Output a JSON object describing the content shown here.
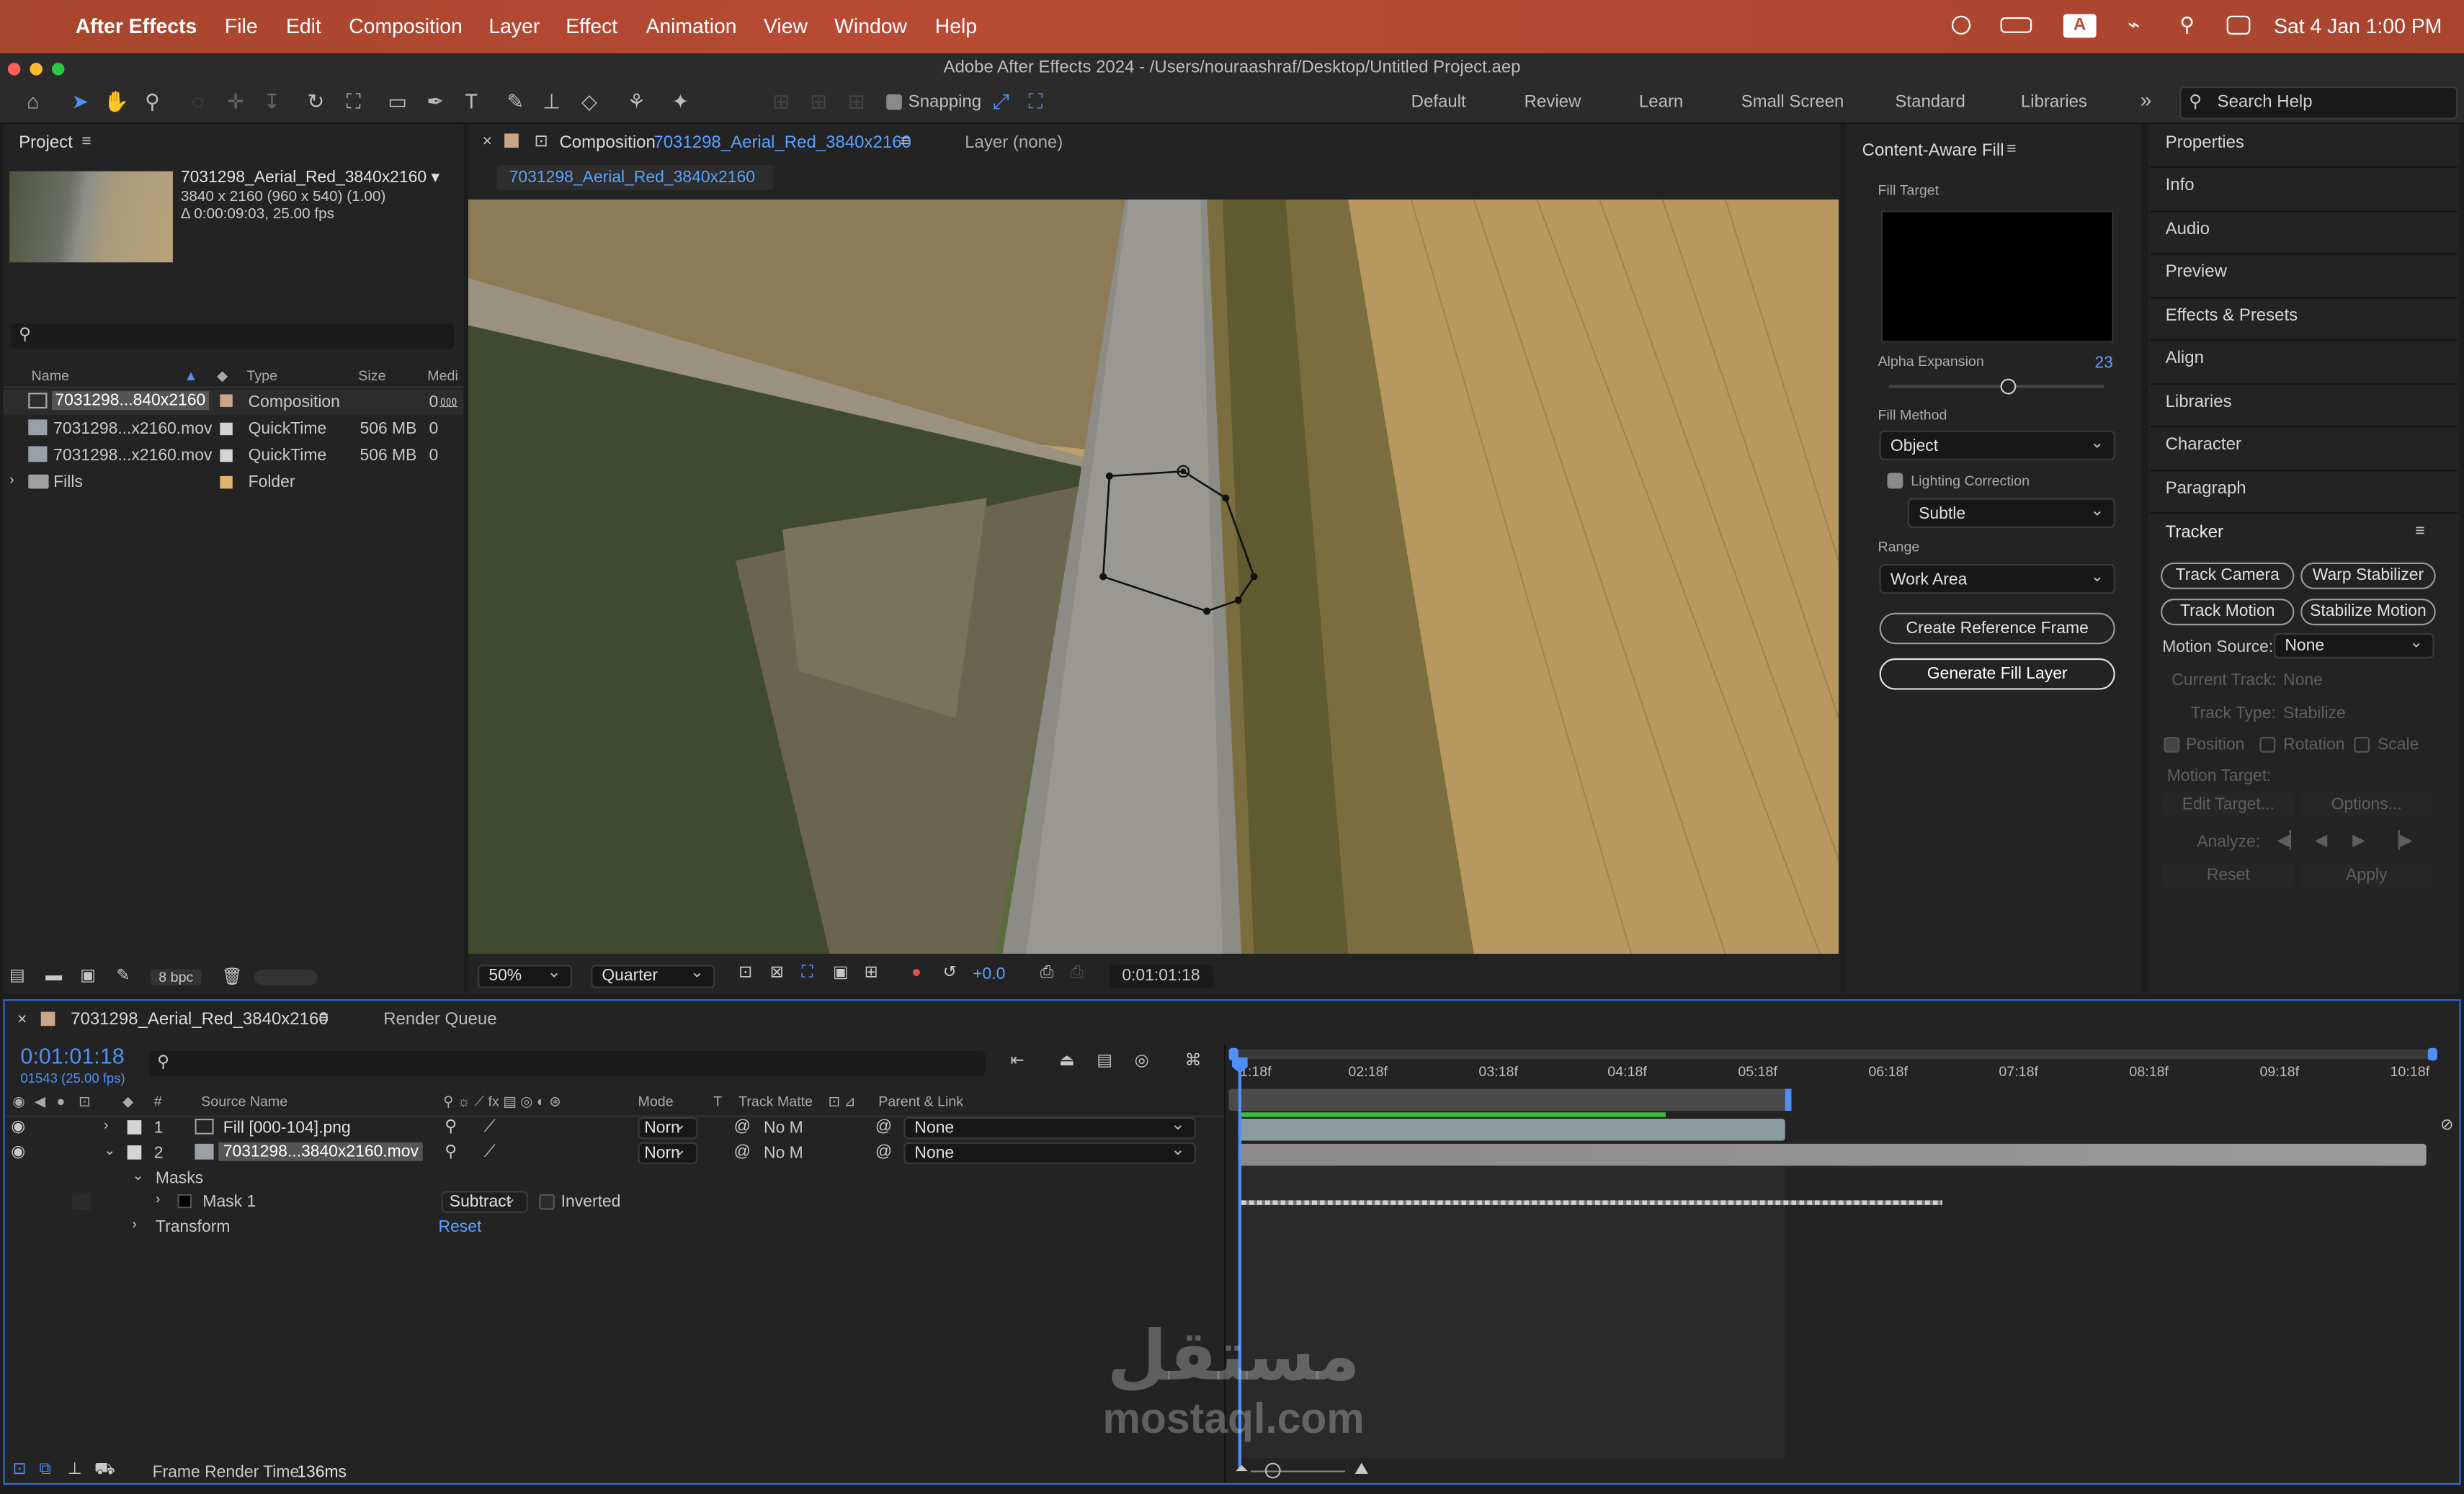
{
  "menubar": {
    "app": "After Effects",
    "items": [
      "File",
      "Edit",
      "Composition",
      "Layer",
      "Effect",
      "Animation",
      "View",
      "Window",
      "Help"
    ],
    "status_badge": "A",
    "datetime": "Sat 4 Jan  1:00 PM"
  },
  "window": {
    "title": "Adobe After Effects 2024 - /Users/nouraashraf/Desktop/Untitled Project.aep"
  },
  "toolbar": {
    "snapping_label": "Snapping",
    "workspaces": [
      "Default",
      "Review",
      "Learn",
      "Small Screen",
      "Standard",
      "Libraries"
    ],
    "search_placeholder": "Search Help"
  },
  "project": {
    "title": "Project",
    "thumb_name": "7031298_Aerial_Red_3840x2160 ▾",
    "thumb_info1": "3840 x 2160  (960 x 540) (1.00)",
    "thumb_info2": "Δ 0:00:09:03, 25.00 fps",
    "columns": {
      "name": "Name",
      "type": "Type",
      "size": "Size",
      "media": "Medi"
    },
    "items": [
      {
        "name": "7031298...840x2160",
        "type": "Composition",
        "size": "",
        "media": "0"
      },
      {
        "name": "7031298...x2160.mov",
        "type": "QuickTime",
        "size": "506 MB",
        "media": "0"
      },
      {
        "name": "7031298...x2160.mov",
        "type": "QuickTime",
        "size": "506 MB",
        "media": "0"
      },
      {
        "name": "Fills",
        "type": "Folder",
        "size": "",
        "media": ""
      }
    ],
    "bpc": "8 bpc"
  },
  "composition": {
    "tab_prefix": "Composition",
    "tab_name": "7031298_Aerial_Red_3840x2160",
    "layer_tab": "Layer (none)",
    "breadcrumb": "7031298_Aerial_Red_3840x2160",
    "zoom": "50%",
    "resolution": "Quarter",
    "exposure": "+0.0",
    "timecode": "0:01:01:18"
  },
  "caf": {
    "title": "Content-Aware Fill",
    "fill_target": "Fill Target",
    "alpha_label": "Alpha Expansion",
    "alpha_value": "23",
    "alpha_level": 0.55,
    "fill_method_label": "Fill Method",
    "fill_method": "Object",
    "lighting_label": "Lighting Correction",
    "lighting_value": "Subtle",
    "range_label": "Range",
    "range_value": "Work Area",
    "create_ref": "Create Reference Frame",
    "generate": "Generate Fill Layer"
  },
  "right_panels": [
    "Properties",
    "Info",
    "Audio",
    "Preview",
    "Effects & Presets",
    "Align",
    "Libraries",
    "Character",
    "Paragraph"
  ],
  "tracker": {
    "title": "Tracker",
    "track_camera": "Track Camera",
    "warp_stabilizer": "Warp Stabilizer",
    "track_motion": "Track Motion",
    "stabilize_motion": "Stabilize Motion",
    "motion_source_label": "Motion Source:",
    "motion_source": "None",
    "current_track_label": "Current Track:",
    "current_track": "None",
    "track_type_label": "Track Type:",
    "track_type": "Stabilize",
    "position": "Position",
    "rotation": "Rotation",
    "scale": "Scale",
    "motion_target": "Motion Target:",
    "edit_target": "Edit Target...",
    "options": "Options...",
    "analyze": "Analyze:",
    "reset": "Reset",
    "apply": "Apply"
  },
  "timeline": {
    "tab_name": "7031298_Aerial_Red_3840x2160",
    "render_queue": "Render Queue",
    "timecode": "0:01:01:18",
    "frame_info": "01543 (25.00 fps)",
    "col_source": "Source Name",
    "col_mode": "Mode",
    "col_t": "T",
    "col_matte": "Track Matte",
    "col_parent": "Parent & Link",
    "layers": [
      {
        "num": "1",
        "name": "Fill [000-104].png",
        "mode": "Norn",
        "matte": "No M",
        "parent": "None"
      },
      {
        "num": "2",
        "name": "7031298...3840x2160.mov",
        "mode": "Norn",
        "matte": "No M",
        "parent": "None"
      }
    ],
    "masks_label": "Masks",
    "mask1_label": "Mask 1",
    "mask_mode": "Subtract",
    "inverted": "Inverted",
    "transform_label": "Transform",
    "reset": "Reset",
    "ruler": [
      "1:18f",
      "02:18f",
      "03:18f",
      "04:18f",
      "05:18f",
      "06:18f",
      "07:18f",
      "08:18f",
      "09:18f",
      "10:18f"
    ],
    "frame_render_label": "Frame Render Time",
    "frame_render_value": "136ms"
  },
  "watermark": {
    "arabic": "مستقل",
    "latin": "mostaql.com"
  },
  "colors": {
    "menubar": "#b44a33",
    "accent_blue": "#4f8ff7",
    "green_bar": "#3cbc3c",
    "panel": "#232323"
  }
}
